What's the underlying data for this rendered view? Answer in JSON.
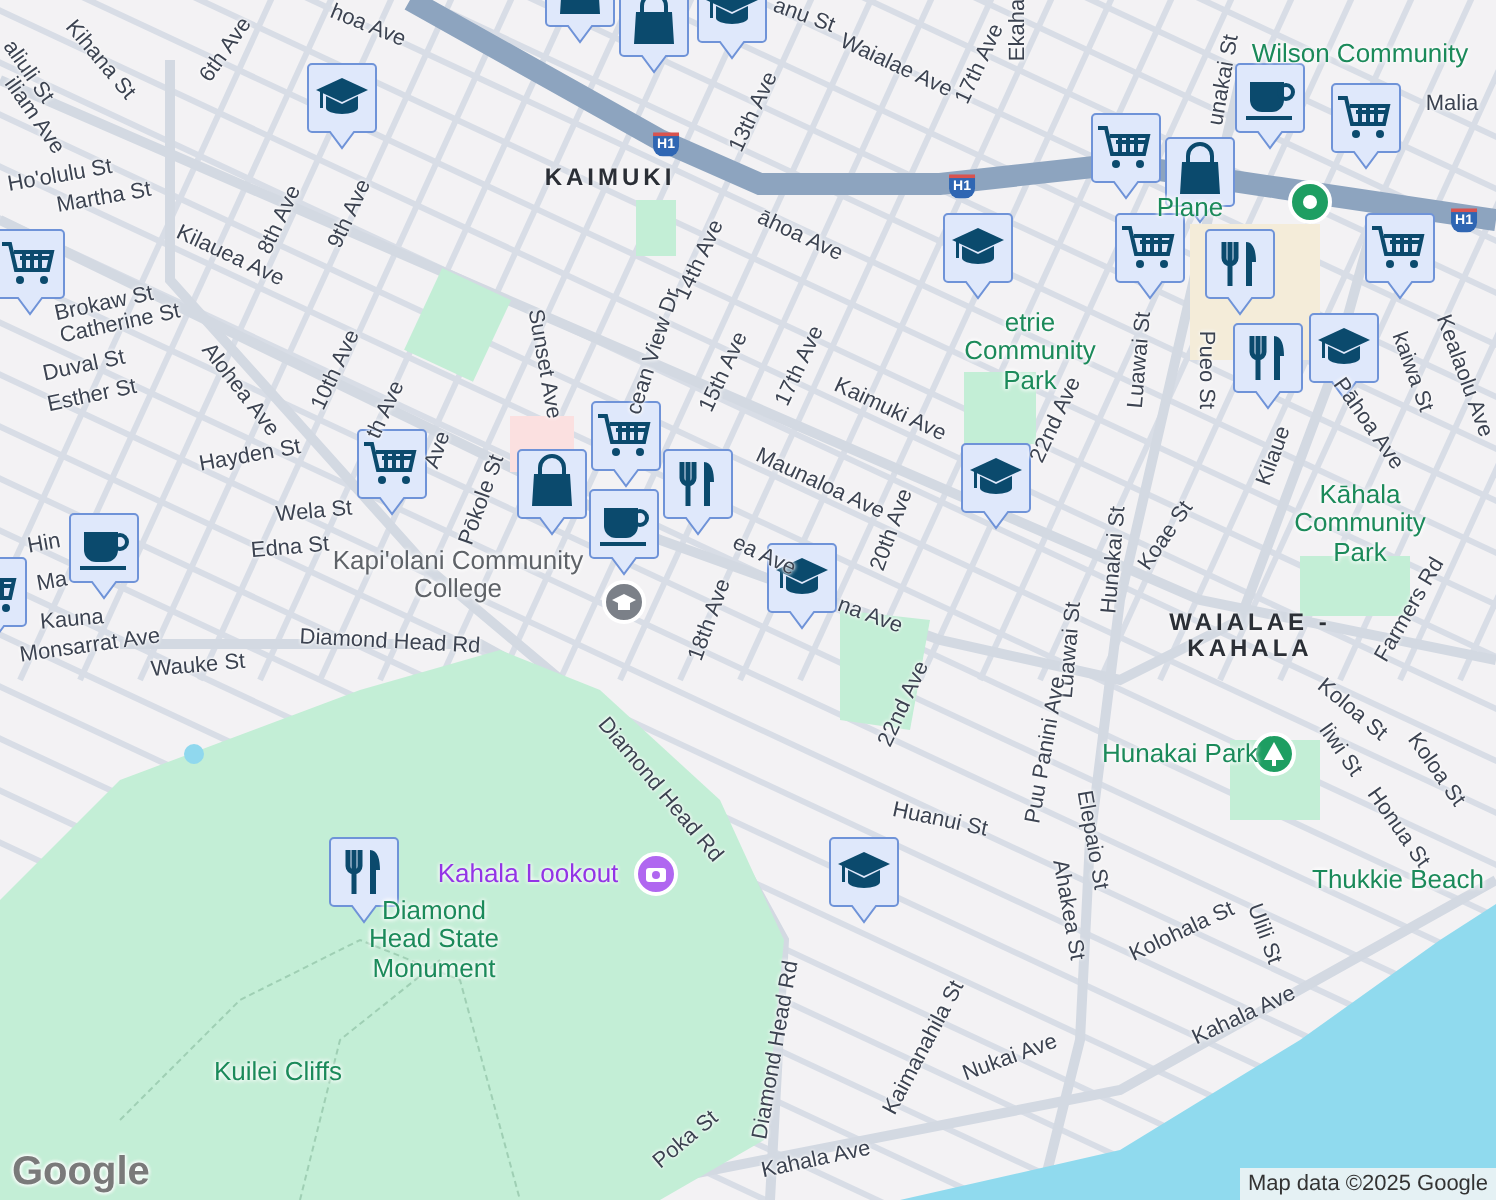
{
  "map": {
    "labels": [
      {
        "text": "aliuli St",
        "kind": "street"
      },
      {
        "text": "Kihana St",
        "kind": "street"
      },
      {
        "text": "iliam Ave",
        "kind": "street"
      },
      {
        "text": "6th Ave",
        "kind": "street"
      },
      {
        "text": "hoa Ave",
        "kind": "street"
      },
      {
        "text": "13th Ave",
        "kind": "street"
      },
      {
        "text": "anu St",
        "kind": "street"
      },
      {
        "text": "Ekaha",
        "kind": "street"
      },
      {
        "text": "17th Ave",
        "kind": "street"
      },
      {
        "text": "Waialae Ave",
        "kind": "street"
      },
      {
        "text": "Wilson Community",
        "kind": "park"
      },
      {
        "text": "Malia",
        "kind": "street"
      },
      {
        "text": "unakai St",
        "kind": "street"
      },
      {
        "text": "Ho'olulu St",
        "kind": "street"
      },
      {
        "text": "Martha St",
        "kind": "street"
      },
      {
        "text": "KAIMUKI",
        "kind": "district"
      },
      {
        "text": "8th Ave",
        "kind": "street"
      },
      {
        "text": "9th Ave",
        "kind": "street"
      },
      {
        "text": "Kilauea Ave",
        "kind": "street"
      },
      {
        "text": "14th Ave",
        "kind": "street"
      },
      {
        "text": "āhoa Ave",
        "kind": "street"
      },
      {
        "text": "Plane",
        "kind": "park"
      },
      {
        "text": "etrie Community Park",
        "kind": "park"
      },
      {
        "text": "Luawai St",
        "kind": "street"
      },
      {
        "text": "Brokaw St",
        "kind": "street"
      },
      {
        "text": "Catherine St",
        "kind": "street"
      },
      {
        "text": "Sunset Ave",
        "kind": "street"
      },
      {
        "text": "15th Ave",
        "kind": "street"
      },
      {
        "text": "cean View Dr",
        "kind": "street"
      },
      {
        "text": "Duval St",
        "kind": "street"
      },
      {
        "text": "Esther St",
        "kind": "street"
      },
      {
        "text": "Alohea Ave",
        "kind": "street"
      },
      {
        "text": "10th Ave",
        "kind": "street"
      },
      {
        "text": "17th Ave",
        "kind": "street"
      },
      {
        "text": "Kaimuki Ave",
        "kind": "street"
      },
      {
        "text": "22nd Ave",
        "kind": "street"
      },
      {
        "text": "Pueo St",
        "kind": "street"
      },
      {
        "text": "Kilaue",
        "kind": "street"
      },
      {
        "text": "Pāhoa Ave",
        "kind": "street"
      },
      {
        "text": "kaiwa St",
        "kind": "street"
      },
      {
        "text": "Kealaolu Ave",
        "kind": "street"
      },
      {
        "text": "Hayden St",
        "kind": "street"
      },
      {
        "text": "th Ave",
        "kind": "street"
      },
      {
        "text": "Ave",
        "kind": "street"
      },
      {
        "text": "Maunaloa Ave",
        "kind": "street"
      },
      {
        "text": "20th Ave",
        "kind": "street"
      },
      {
        "text": "Pōkole St",
        "kind": "street"
      },
      {
        "text": "Wela St",
        "kind": "street"
      },
      {
        "text": "Edna St",
        "kind": "street"
      },
      {
        "text": "ea Ave",
        "kind": "street"
      },
      {
        "text": "Hunakai St",
        "kind": "street"
      },
      {
        "text": "Koae St",
        "kind": "street"
      },
      {
        "text": "Kāhala Community Park",
        "kind": "park"
      },
      {
        "text": "Hin",
        "kind": "street"
      },
      {
        "text": "Ma",
        "kind": "street"
      },
      {
        "text": "Kapi'olani Community College",
        "kind": "campus"
      },
      {
        "text": "Kauna",
        "kind": "street"
      },
      {
        "text": "na Ave",
        "kind": "street"
      },
      {
        "text": "18th Ave",
        "kind": "street"
      },
      {
        "text": "Monsarrat Ave",
        "kind": "street"
      },
      {
        "text": "Diamond Head Rd",
        "kind": "street"
      },
      {
        "text": "Wauke St",
        "kind": "street"
      },
      {
        "text": "Luawai St",
        "kind": "street"
      },
      {
        "text": "WAIALAE - KAHALA",
        "kind": "district"
      },
      {
        "text": "Farmers Rd",
        "kind": "street"
      },
      {
        "text": "22nd Ave",
        "kind": "street"
      },
      {
        "text": "Koloa St",
        "kind": "street"
      },
      {
        "text": "Hunakai Park",
        "kind": "park"
      },
      {
        "text": "Iiwi St",
        "kind": "street"
      },
      {
        "text": "Koloa St",
        "kind": "street"
      },
      {
        "text": "Puu Panini Ave",
        "kind": "street"
      },
      {
        "text": "Diamond Head Rd",
        "kind": "street"
      },
      {
        "text": "Huanui St",
        "kind": "street"
      },
      {
        "text": "Honua St",
        "kind": "street"
      },
      {
        "text": "Elepaio St",
        "kind": "street"
      },
      {
        "text": "Kahala Lookout",
        "kind": "landmark"
      },
      {
        "text": "Thukkie Beach",
        "kind": "park"
      },
      {
        "text": "Diamond Head State Monument",
        "kind": "park"
      },
      {
        "text": "Ahakea St",
        "kind": "street"
      },
      {
        "text": "Kolohala St",
        "kind": "street"
      },
      {
        "text": "Ulili St",
        "kind": "street"
      },
      {
        "text": "Kahala Ave",
        "kind": "street"
      },
      {
        "text": "Nukai Ave",
        "kind": "street"
      },
      {
        "text": "Kaimanahila St",
        "kind": "street"
      },
      {
        "text": "Diamond Head Rd",
        "kind": "street"
      },
      {
        "text": "Kuilei Cliffs",
        "kind": "park"
      },
      {
        "text": "Poka St",
        "kind": "street"
      },
      {
        "text": "Kahala Ave",
        "kind": "street"
      },
      {
        "text": "H1",
        "kind": "shield"
      },
      {
        "text": "H1",
        "kind": "shield"
      },
      {
        "text": "H1",
        "kind": "shield"
      }
    ],
    "markers": [
      {
        "kind": "shop"
      },
      {
        "kind": "shop"
      },
      {
        "kind": "school"
      },
      {
        "kind": "school"
      },
      {
        "kind": "grocery"
      },
      {
        "kind": "grocery"
      },
      {
        "kind": "grocery"
      },
      {
        "kind": "shop"
      },
      {
        "kind": "restaurant"
      },
      {
        "kind": "cafe"
      },
      {
        "kind": "grocery"
      },
      {
        "kind": "cafe"
      },
      {
        "kind": "school"
      },
      {
        "kind": "cafe"
      },
      {
        "kind": "grocery"
      },
      {
        "kind": "shop"
      },
      {
        "kind": "restaurant"
      },
      {
        "kind": "restaurant"
      },
      {
        "kind": "school"
      },
      {
        "kind": "grocery"
      },
      {
        "kind": "grocery"
      },
      {
        "kind": "grocery"
      },
      {
        "kind": "school"
      },
      {
        "kind": "school"
      },
      {
        "kind": "restaurant"
      },
      {
        "kind": "school"
      },
      {
        "kind": "campus"
      },
      {
        "kind": "place"
      },
      {
        "kind": "camera"
      },
      {
        "kind": "park"
      }
    ],
    "logo": "Google",
    "attribution": "Map data ©2025 Google"
  }
}
